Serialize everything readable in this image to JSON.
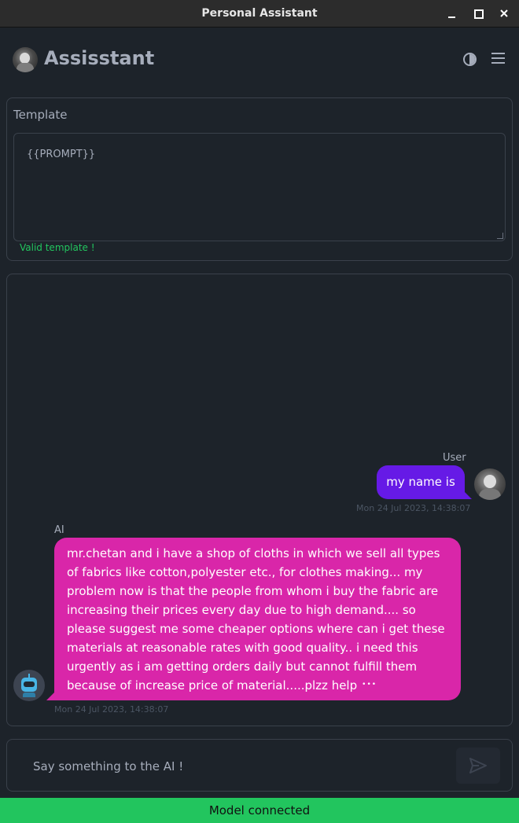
{
  "window": {
    "title": "Personal Assistant",
    "controls": [
      "minimize-icon",
      "maximize-icon",
      "close-icon"
    ]
  },
  "header": {
    "app_name": "Assisstant",
    "logo_icon": "avatar-logo",
    "theme_icon": "theme-toggle-icon",
    "menu_icon": "hamburger-menu-icon"
  },
  "template": {
    "label": "Template",
    "value": "{{PROMPT}}",
    "validation": "Valid template !"
  },
  "chat": {
    "messages": [
      {
        "sender": "User",
        "text": "my name is",
        "timestamp": "Mon 24 Jul 2023, 14:38:07",
        "color": "#661ae6"
      },
      {
        "sender": "AI",
        "text": "mr.chetan and i have a shop of cloths in which we sell all types of fabrics like cotton,polyester etc., for clothes making... my problem now is that the people from whom i buy the fabric are increasing their prices every day due to high demand.... so please suggest me some cheaper options where can i get these materials at reasonable rates with good quality.. i need this urgently as i am getting orders daily but cannot fulfill them because of increase price of material.....plzz help",
        "typing_indicator": "•••",
        "timestamp": "Mon 24 Jul 2023, 14:38:07",
        "color": "#d926a9"
      }
    ]
  },
  "composer": {
    "placeholder": "Say something to the AI !",
    "send_icon": "send-icon"
  },
  "status": {
    "text": "Model connected",
    "color": "#22c55e"
  }
}
